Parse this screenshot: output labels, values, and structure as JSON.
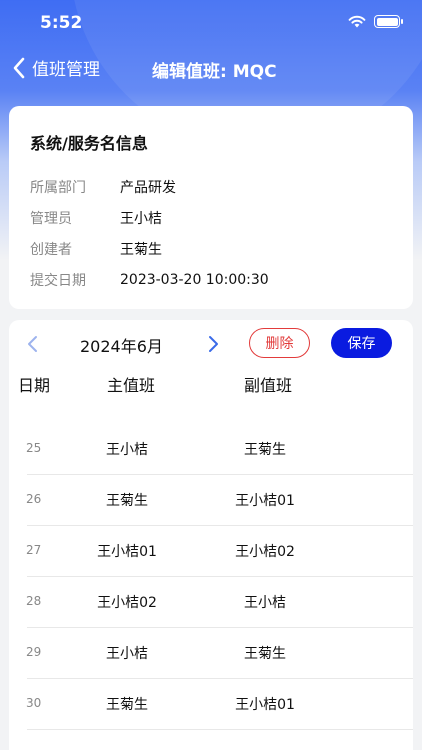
{
  "status_bar": {
    "time": "5:52"
  },
  "nav": {
    "back_label": "值班管理",
    "title": "编辑值班: MQC"
  },
  "info": {
    "title": "系统/服务名信息",
    "rows": [
      {
        "label": "所属部门",
        "value": "产品研发"
      },
      {
        "label": "管理员",
        "value": "王小桔"
      },
      {
        "label": "创建者",
        "value": "王菊生"
      },
      {
        "label": "提交日期",
        "value": "2023-03-20 10:00:30"
      }
    ]
  },
  "calendar": {
    "month": "2024年6月",
    "delete_label": "删除",
    "save_label": "保存",
    "headers": {
      "date": "日期",
      "main": "主值班",
      "vice": "副值班"
    },
    "rows": [
      {
        "day": "25",
        "main": "王小桔",
        "vice": "王菊生"
      },
      {
        "day": "26",
        "main": "王菊生",
        "vice": "王小桔01"
      },
      {
        "day": "27",
        "main": "王小桔01",
        "vice": "王小桔02"
      },
      {
        "day": "28",
        "main": "王小桔02",
        "vice": "王小桔"
      },
      {
        "day": "29",
        "main": "王小桔",
        "vice": "王菊生"
      },
      {
        "day": "30",
        "main": "王菊生",
        "vice": "王小桔01"
      }
    ]
  },
  "colors": {
    "primary": "#0a1be0",
    "danger": "#e23b3b",
    "header_gradient_top": "#3f6df3",
    "arrow": "#3a6be8"
  },
  "icons": [
    "back-chevron-icon",
    "wifi-icon",
    "battery-icon",
    "chevron-left-icon",
    "chevron-right-icon"
  ]
}
